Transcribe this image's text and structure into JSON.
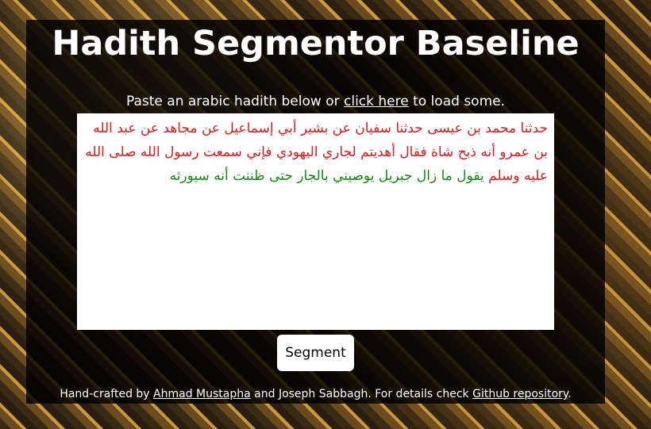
{
  "page": {
    "title": "Hadith Segmentor Baseline"
  },
  "instructions": {
    "before": "Paste an arabic hadith below or ",
    "link": "click here",
    "after": " to load some."
  },
  "editor": {
    "segments": [
      {
        "text": "حدثنا محمد بن عيسى حدثنا سفيان عن بشير أبي إسماعيل عن مجاهد عن عبد الله بن عمرو أنه ذبح شاة فقال أهديتم لجاري اليهودي فإني سمعت رسول الله صلى الله عليه وسلم ",
        "color": "#e2191b"
      },
      {
        "text": "يقول ما زال جبريل يوصيني بالجار حتى ظننت أنه سيورثه",
        "color": "#118a11"
      }
    ]
  },
  "actions": {
    "segment_label": "Segment"
  },
  "footer": {
    "prefix": "Hand-crafted by ",
    "author1": "Ahmad Mustapha",
    "middle": " and Joseph Sabbagh. For details check ",
    "repo_link": "Github repository",
    "suffix": "."
  }
}
